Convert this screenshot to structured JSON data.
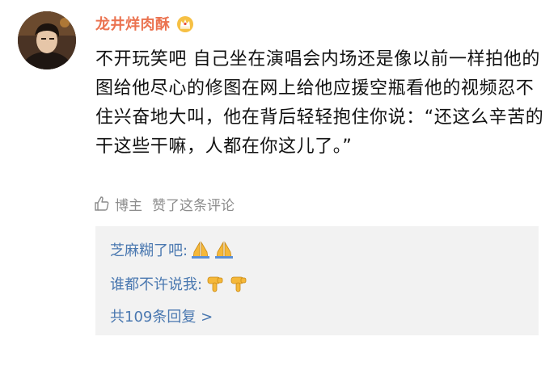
{
  "comment": {
    "username": "龙井烊肉酥",
    "badge_icon": "vip-crown-icon",
    "text": "不开玩笑吧 自己坐在演唱会内场还是像以前一样拍他的图给他尽心的修图在网上给他应援空瓶看他的视频忍不住兴奋地大叫，他在背后轻轻抱住你说：“还这么辛苦的干这些干嘛，人都在你这儿了。”"
  },
  "like_info": {
    "icon": "thumbs-up-icon",
    "author_label": "博主",
    "text": "赞了这条评论"
  },
  "replies": [
    {
      "text": "芝麻糊了吧:",
      "emoji": "folded-hands-emoji"
    },
    {
      "text": "谁都不许说我:",
      "emoji": "pointing-down-emoji"
    }
  ],
  "more_replies": "共109条回复 >",
  "colors": {
    "username": "#eb7350",
    "link": "#4a78b0",
    "body_text": "#111111",
    "meta_text": "#8c8c8c",
    "reply_bg": "#f2f2f2"
  }
}
